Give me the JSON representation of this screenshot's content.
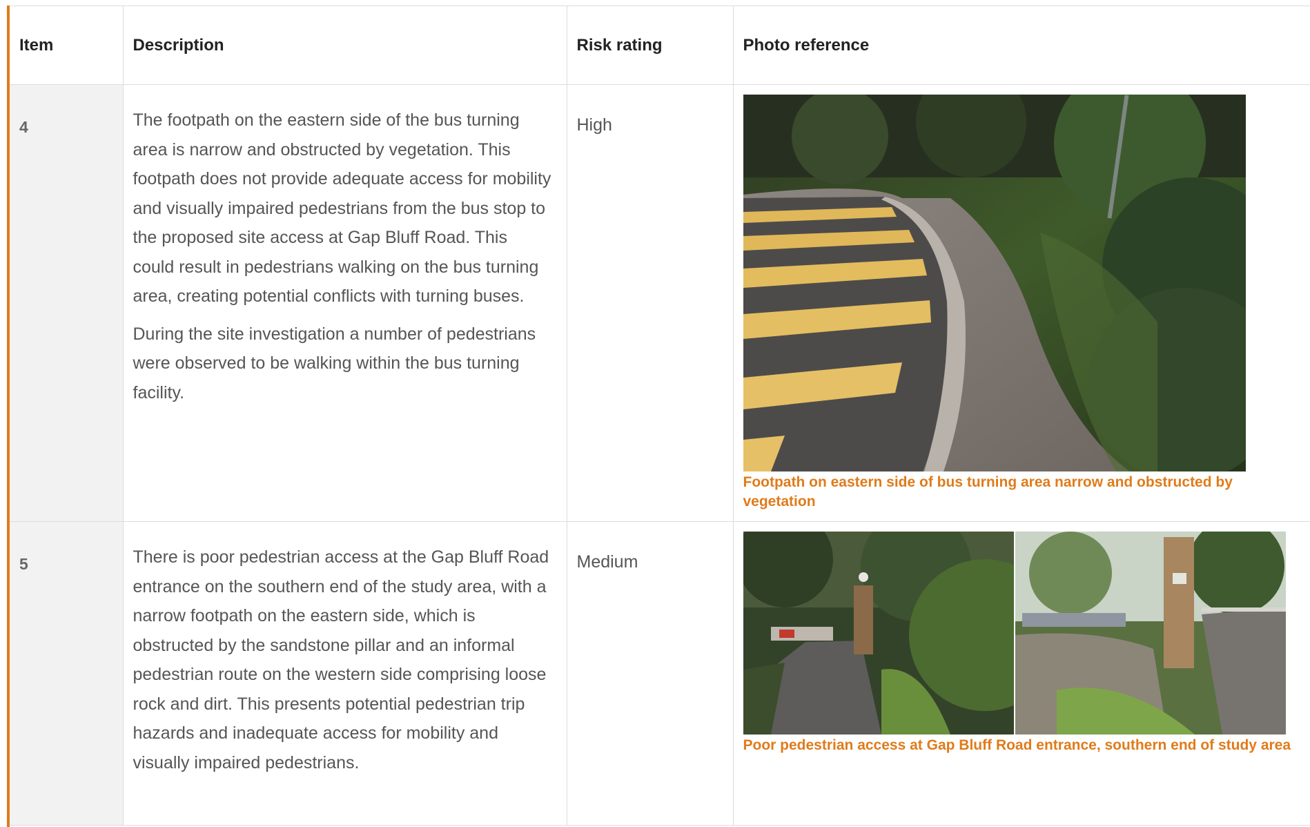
{
  "table": {
    "headers": {
      "item": "Item",
      "description": "Description",
      "risk": "Risk rating",
      "photo": "Photo reference"
    },
    "rows": [
      {
        "item": "4",
        "description_1": "The footpath on the eastern side of the bus turning area is narrow and obstructed by vegetation. This footpath does not provide adequate access for mobility and visually impaired pedestrians from the bus stop to the proposed site access at Gap Bluff Road. This could result in pedestrians walking on the bus turning area, creating potential conflicts with turning buses.",
        "description_2": "During the site investigation a number of pedestrians were observed to be walking within the bus turning facility.",
        "risk": "High",
        "photo_caption": "Footpath on eastern side of bus turning area narrow and obstructed by vegetation"
      },
      {
        "item": "5",
        "description_1": "There is poor pedestrian access at the Gap Bluff Road entrance on the southern end of the study area, with a narrow footpath on the eastern side, which is obstructed by the sandstone pillar and an informal pedestrian route on the western side comprising loose rock and dirt. This presents potential pedestrian trip hazards and inadequate access for mobility and visually impaired pedestrians.",
        "risk": "Medium",
        "photo_caption": "Poor pedestrian access at Gap Bluff Road entrance, southern end of study area"
      }
    ]
  },
  "colors": {
    "accent": "#e07b1a",
    "item_column_bg": "#f2f2f2",
    "border": "#dcdcdc"
  }
}
